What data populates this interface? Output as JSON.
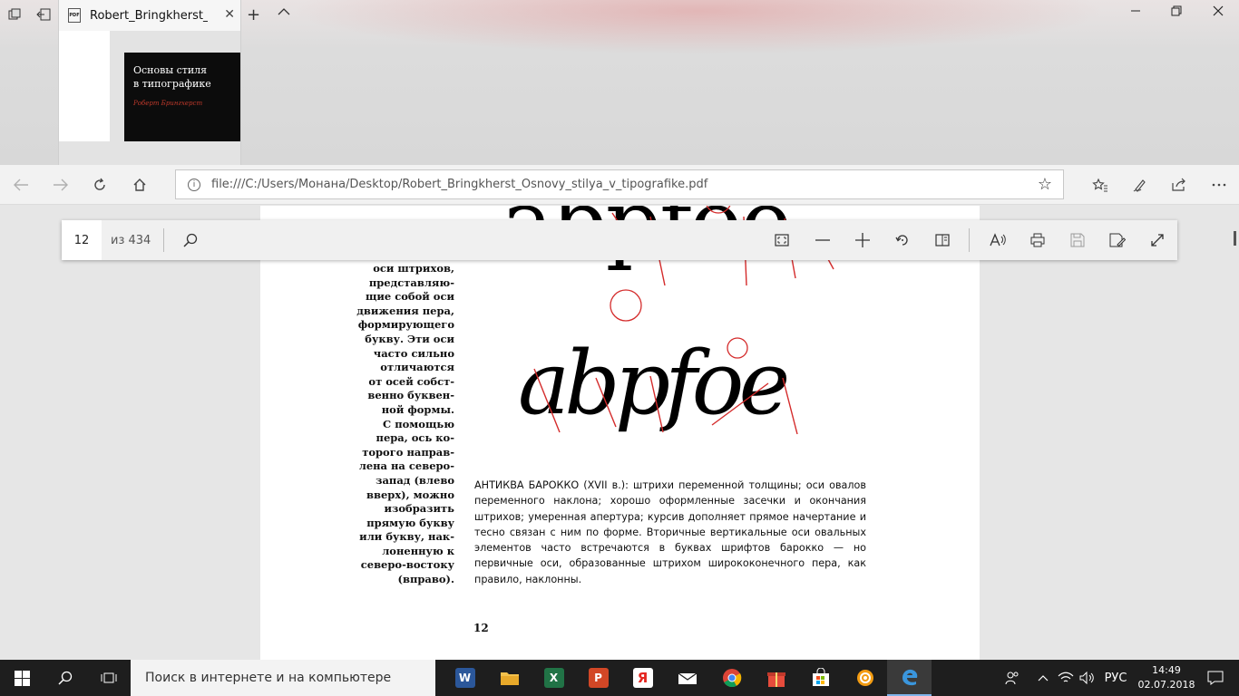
{
  "tab": {
    "title": "Robert_Bringkherst_Osr",
    "preview_title_line1": "Основы стиля",
    "preview_title_line2": "в типографике",
    "preview_author": "Роберт Брингхерст"
  },
  "address": {
    "url": "file:///C:/Users/Монана/Desktop/Robert_Bringkherst_Osnovy_stilya_v_tipografike.pdf"
  },
  "pdf_toolbar": {
    "page": "12",
    "page_count": "из 434"
  },
  "page_content": {
    "glyphs_top": "abpfoe",
    "glyphs_bottom": "abpfoe",
    "sidenote_lines": [
      "оси штрихов,",
      "представляю-",
      "щие собой оси",
      "движения пера,",
      "формирующего",
      "букву. Эти оси",
      "часто сильно",
      "отличаются",
      "от осей собст-",
      "венно буквен-",
      "ной формы.",
      "С помощью",
      "пера, ось ко-",
      "торого направ-",
      "лена на северо-",
      "запад (влево",
      "вверх), можно",
      "изобразить",
      "прямую букву",
      "или букву, нак-",
      "лоненную к",
      "северо-востоку",
      "(вправо)."
    ],
    "caption": "АНТИКВА БАРОККО (XVII в.): штрихи переменной толщины; оси овалов переменного наклона; хорошо оформленные засечки и окончания штрихов; умеренная апертура; курсив дополняет прямое начертание и тесно связан с ним по форме. Вторичные вертикальные оси овальных элементов часто встречаются в буквах шрифтов барокко — но первичные оси, образованные штрихом ширококонечного пера, как правило, наклонны.",
    "page_number": "12"
  },
  "taskbar": {
    "search_placeholder": "Поиск в интернете и на компьютере",
    "language": "РУС",
    "time": "14:49",
    "date": "02.07.2018"
  },
  "colors": {
    "taskbar_bg": "#1e1e1e",
    "accent": "#7fb4ea",
    "axis_red": "#d42b2b"
  }
}
